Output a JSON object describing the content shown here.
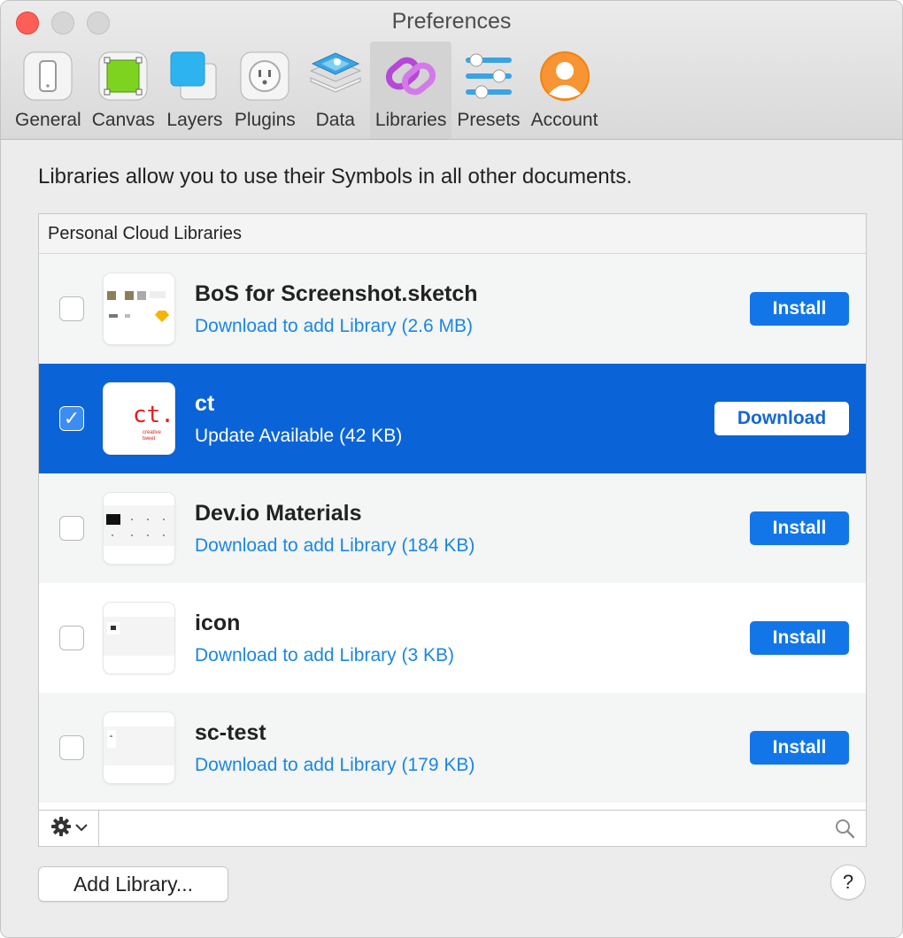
{
  "window": {
    "title": "Preferences"
  },
  "toolbar": {
    "items": [
      {
        "label": "General",
        "icon": "general-icon"
      },
      {
        "label": "Canvas",
        "icon": "canvas-icon"
      },
      {
        "label": "Layers",
        "icon": "layers-icon"
      },
      {
        "label": "Plugins",
        "icon": "plugins-icon"
      },
      {
        "label": "Data",
        "icon": "data-icon"
      },
      {
        "label": "Libraries",
        "icon": "libraries-icon",
        "active": true
      },
      {
        "label": "Presets",
        "icon": "presets-icon"
      },
      {
        "label": "Account",
        "icon": "account-icon"
      }
    ]
  },
  "intro_text": "Libraries allow you to use their Symbols in all other documents.",
  "libraries": {
    "header": "Personal Cloud Libraries",
    "rows": [
      {
        "name": "BoS for Screenshot.sketch",
        "status": "Download to add Library (2.6 MB)",
        "button": "Install",
        "checked": false
      },
      {
        "name": "ct",
        "status": "Update Available (42 KB)",
        "button": "Download",
        "checked": true,
        "thumb_text": "ct.",
        "thumb_small": "creative tweet"
      },
      {
        "name": "Dev.io Materials",
        "status": "Download to add Library (184 KB)",
        "button": "Install",
        "checked": false
      },
      {
        "name": "icon",
        "status": "Download to add Library (3 KB)",
        "button": "Install",
        "checked": false
      },
      {
        "name": "sc-test",
        "status": "Download to add Library (179 KB)",
        "button": "Install",
        "checked": false
      }
    ]
  },
  "footer": {
    "add_library": "Add Library...",
    "help": "?"
  },
  "colors": {
    "accent": "#1376e8",
    "selection": "#0a64d8",
    "link": "#1a87e6"
  }
}
